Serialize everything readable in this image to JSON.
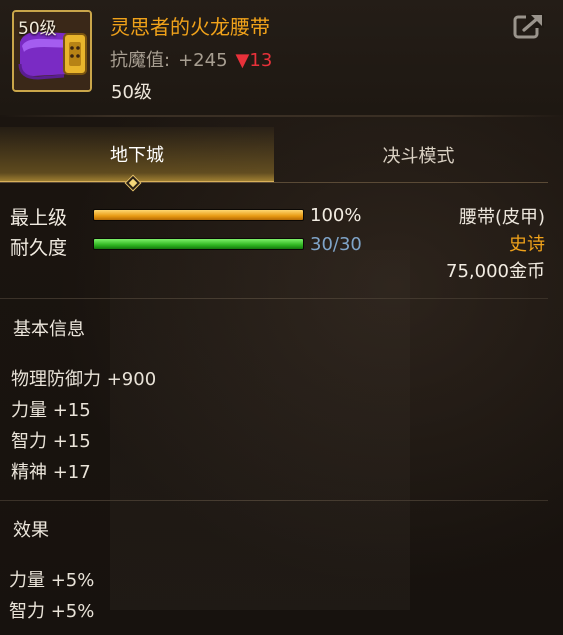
{
  "item": {
    "level_badge": "50级",
    "name": "灵思者的火龙腰带",
    "stat_name": "抗魔值:",
    "stat_value": "+245",
    "stat_diff": "▼13",
    "required_level": "50级",
    "icon": "purple-belt-icon"
  },
  "header": {
    "share_icon": "share-export-icon"
  },
  "tabs": [
    {
      "label": "地下城",
      "active": true
    },
    {
      "label": "决斗模式",
      "active": false
    }
  ],
  "bars": {
    "level": {
      "label": "最上级",
      "value": "100%",
      "fraction": 1.0
    },
    "durability": {
      "label": "耐久度",
      "value": "30/30",
      "fraction": 1.0
    }
  },
  "item_info": {
    "type": "腰带(皮甲)",
    "rarity": "史诗",
    "price": "75,000金币"
  },
  "basic_info": {
    "title": "基本信息",
    "stats": [
      "物理防御力 +900",
      "力量 +15",
      "智力 +15",
      "精神 +17"
    ]
  },
  "effects": {
    "title": "效果",
    "stats": [
      "力量 +5%",
      "智力 +5%"
    ]
  },
  "colors": {
    "item_name": "#f0a21a",
    "rarity": "#f0a21a",
    "durability_value": "#7fa4c8",
    "stat_down": "#e8313a",
    "frame_gold": "#caa64a"
  }
}
